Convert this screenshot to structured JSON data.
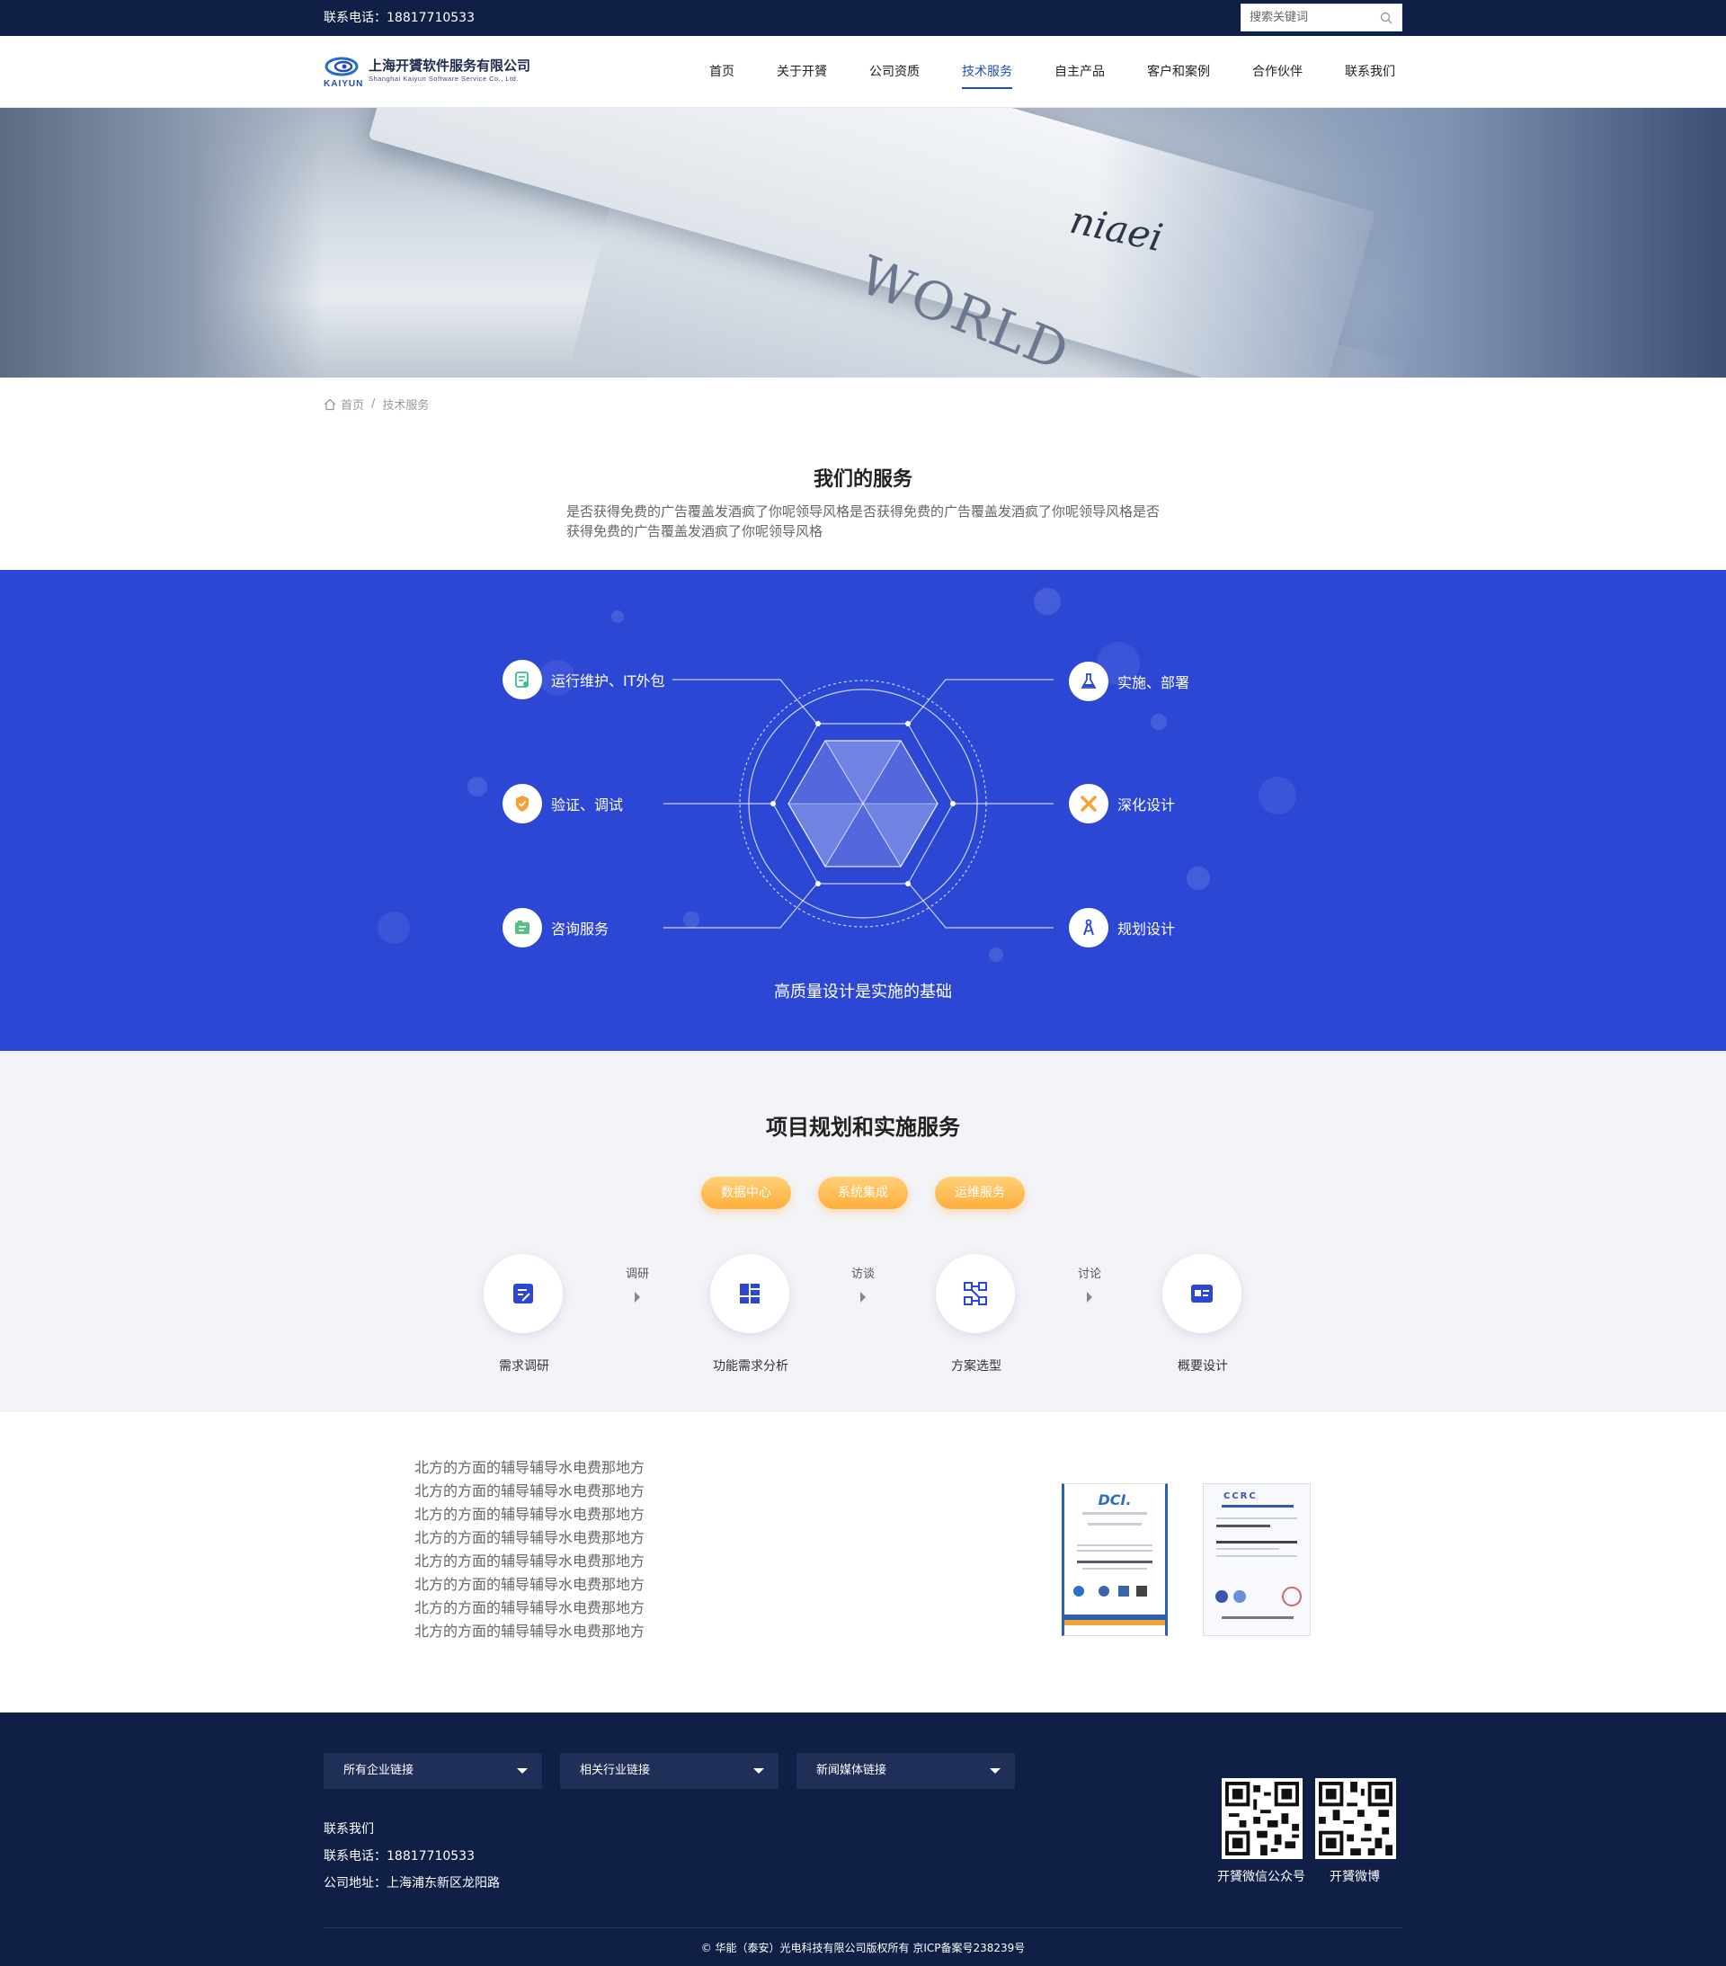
{
  "topbar": {
    "phone": "联系电话：18817710533",
    "search_placeholder": "搜索关键词"
  },
  "header": {
    "company_cn": "上海开贇软件服务有限公司",
    "company_en": "Shanghai Kaiyun Software Service Co., Ltd.",
    "logo_word": "KAIYUN",
    "nav": [
      "首页",
      "关于开贇",
      "公司资质",
      "技术服务",
      "自主产品",
      "客户和案例",
      "合作伙伴",
      "联系我们"
    ],
    "active_nav": "技术服务"
  },
  "banner": {
    "word1": "WORLD",
    "word2": "niaei"
  },
  "breadcrumb": {
    "home": "首页",
    "sep": "/",
    "current": "技术服务"
  },
  "services": {
    "title": "我们的服务",
    "desc": "是否获得免费的广告覆盖发酒疯了你呢领导风格是否获得免费的广告覆盖发酒疯了你呢领导风格是否获得免费的广告覆盖发酒疯了你呢领导风格",
    "left_items": [
      "运行维护、IT外包",
      "验证、调试",
      "咨询服务"
    ],
    "right_items": [
      "实施、部署",
      "深化设计",
      "规划设计"
    ],
    "tagline": "高质量设计是实施的基础"
  },
  "project": {
    "title": "项目规划和实施服务",
    "tabs": [
      "数据中心",
      "系统集成",
      "运维服务"
    ],
    "steps": [
      "需求调研",
      "功能需求分析",
      "方案选型",
      "概要设计"
    ],
    "arrows": [
      "调研",
      "访谈",
      "讨论"
    ]
  },
  "text_lines": [
    "北方的方面的辅导辅导水电费那地方",
    "北方的方面的辅导辅导水电费那地方",
    "北方的方面的辅导辅导水电费那地方",
    "北方的方面的辅导辅导水电费那地方",
    "北方的方面的辅导辅导水电费那地方",
    "北方的方面的辅导辅导水电费那地方",
    "北方的方面的辅导辅导水电费那地方",
    "北方的方面的辅导辅导水电费那地方"
  ],
  "certs": {
    "cert1_title": "DCI.",
    "cert2_title": "CCRC"
  },
  "footer": {
    "selects": [
      "所有企业链接",
      "相关行业链接",
      "新闻媒体链接"
    ],
    "contact_title": "联系我们",
    "phone": "联系电话：18817710533",
    "address": "公司地址：上海浦东新区龙阳路",
    "qr_labels": [
      "开贇微信公众号",
      "开贇微博"
    ],
    "copyright": "© 华能（泰安）光电科技有限公司版权所有   京ICP备案号238239号"
  },
  "colors": {
    "navy": "#0f1f45",
    "brand_blue": "#1f4fb3",
    "section_blue": "#2d47d5",
    "orange": "#ffae3a"
  }
}
